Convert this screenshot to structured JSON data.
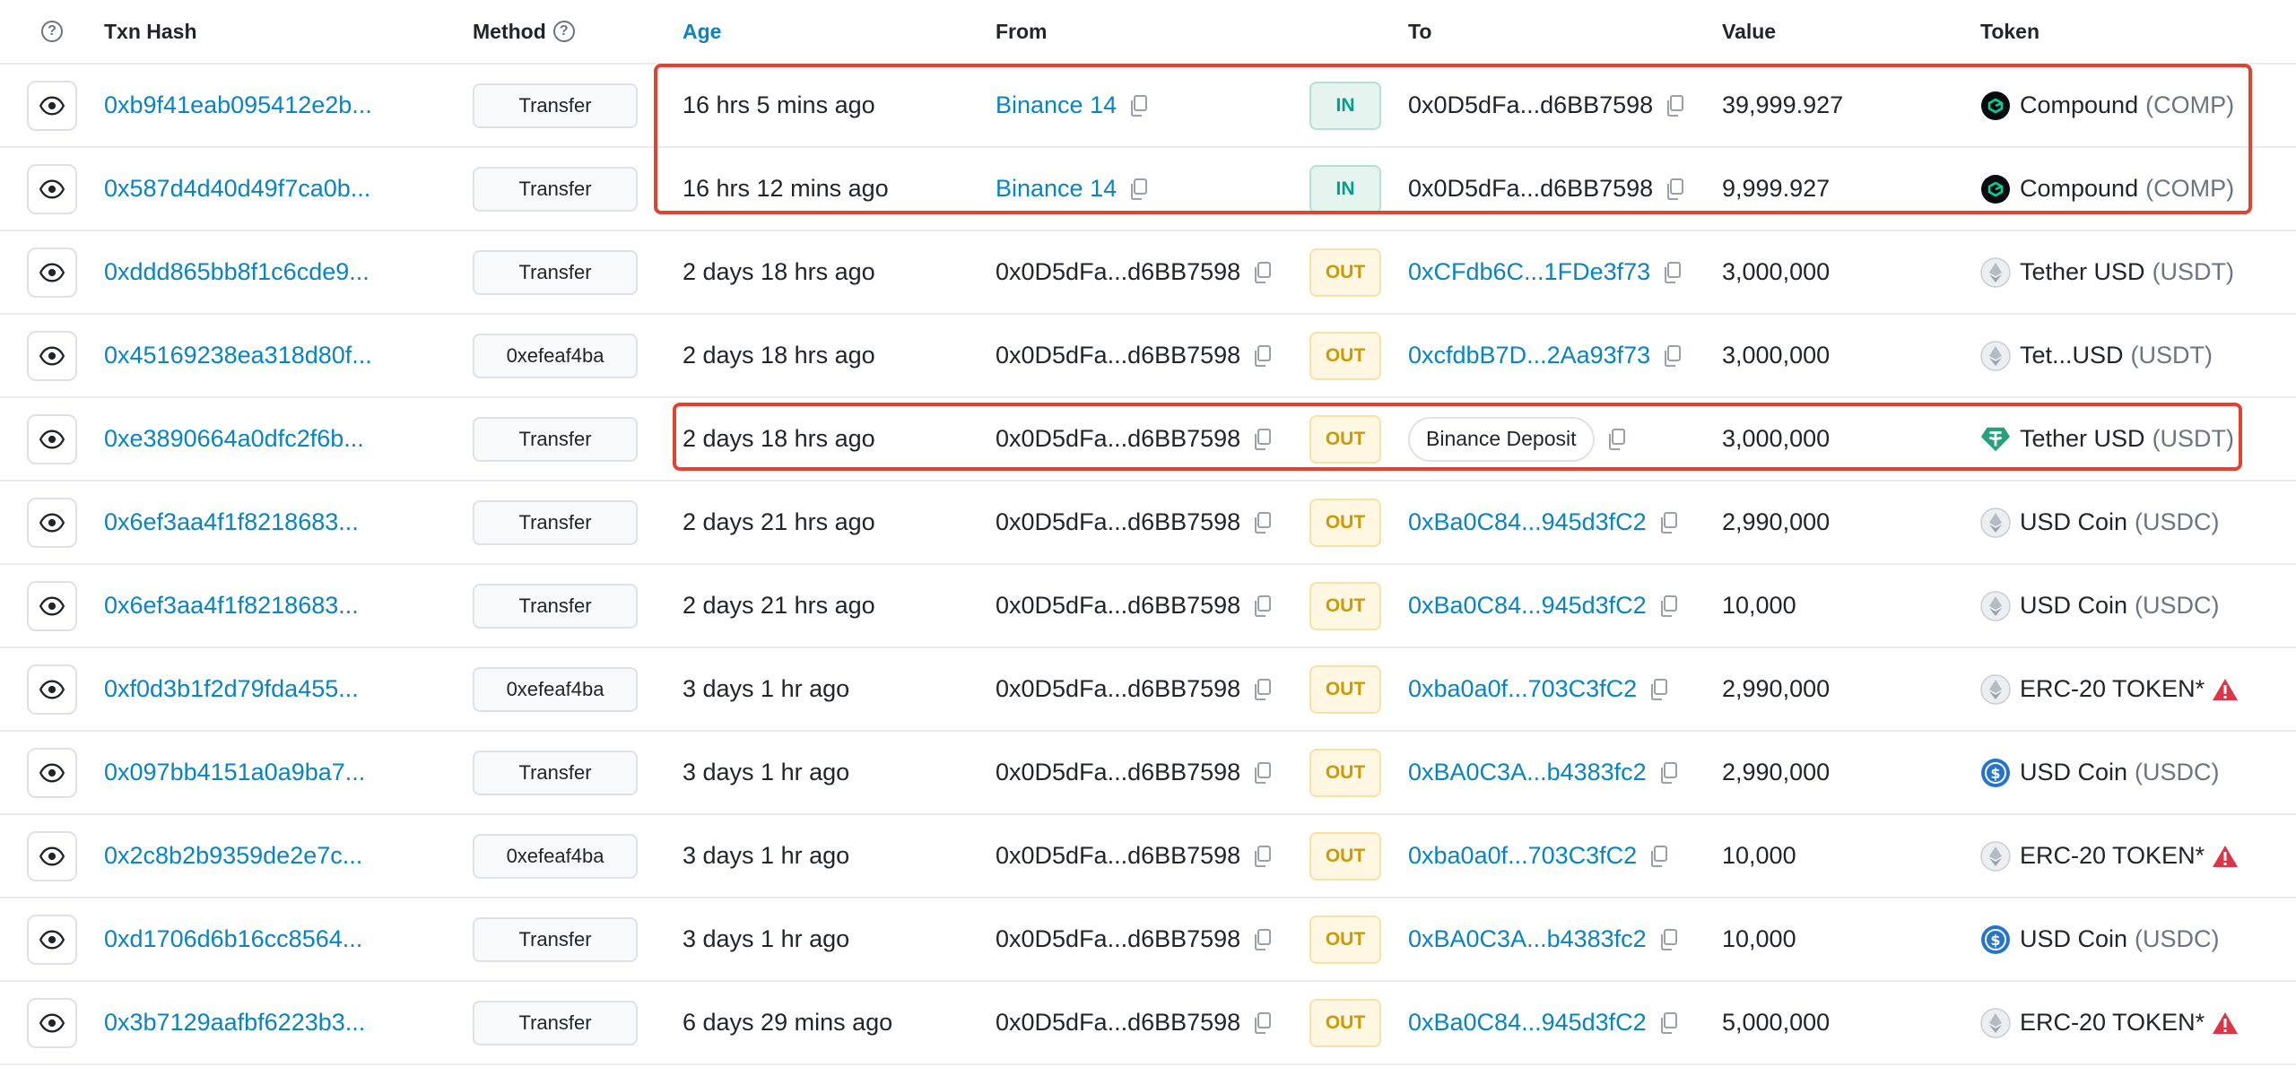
{
  "header": {
    "txn_hash": "Txn Hash",
    "method": "Method",
    "age": "Age",
    "from": "From",
    "to": "To",
    "value": "Value",
    "token": "Token"
  },
  "rows": [
    {
      "hash": "0xb9f41eab095412e2b...",
      "method": "Transfer",
      "age": "16 hrs 5 mins ago",
      "from": "Binance 14",
      "direction": "IN",
      "to": "0x0D5dFa...d6BB7598",
      "value": "39,999.927",
      "token_name": "Compound",
      "token_symbol": "(COMP)",
      "token_icon": "compound-icon"
    },
    {
      "hash": "0x587d4d40d49f7ca0b...",
      "method": "Transfer",
      "age": "16 hrs 12 mins ago",
      "from": "Binance 14",
      "direction": "IN",
      "to": "0x0D5dFa...d6BB7598",
      "value": "9,999.927",
      "token_name": "Compound",
      "token_symbol": "(COMP)",
      "token_icon": "compound-icon"
    },
    {
      "hash": "0xddd865bb8f1c6cde9...",
      "method": "Transfer",
      "age": "2 days 18 hrs ago",
      "from": "0x0D5dFa...d6BB7598",
      "direction": "OUT",
      "to": "0xCFdb6C...1FDe3f73",
      "value": "3,000,000",
      "token_name": "Tether USD",
      "token_symbol": "(USDT)",
      "token_icon": "eth-token-icon"
    },
    {
      "hash": "0x45169238ea318d80f...",
      "method": "0xefeaf4ba",
      "age": "2 days 18 hrs ago",
      "from": "0x0D5dFa...d6BB7598",
      "direction": "OUT",
      "to": "0xcfdbB7D...2Aa93f73",
      "value": "3,000,000",
      "token_name": "Tet...USD",
      "token_symbol": "(USDT)",
      "token_icon": "eth-token-icon"
    },
    {
      "hash": "0xe3890664a0dfc2f6b...",
      "method": "Transfer",
      "age": "2 days 18 hrs ago",
      "from": "0x0D5dFa...d6BB7598",
      "direction": "OUT",
      "to": "Binance Deposit",
      "value": "3,000,000",
      "token_name": "Tether USD",
      "token_symbol": "(USDT)",
      "token_icon": "tether-icon"
    },
    {
      "hash": "0x6ef3aa4f1f8218683...",
      "method": "Transfer",
      "age": "2 days 21 hrs ago",
      "from": "0x0D5dFa...d6BB7598",
      "direction": "OUT",
      "to": "0xBa0C84...945d3fC2",
      "value": "2,990,000",
      "token_name": "USD Coin",
      "token_symbol": "(USDC)",
      "token_icon": "eth-token-icon"
    },
    {
      "hash": "0x6ef3aa4f1f8218683...",
      "method": "Transfer",
      "age": "2 days 21 hrs ago",
      "from": "0x0D5dFa...d6BB7598",
      "direction": "OUT",
      "to": "0xBa0C84...945d3fC2",
      "value": "10,000",
      "token_name": "USD Coin",
      "token_symbol": "(USDC)",
      "token_icon": "eth-token-icon"
    },
    {
      "hash": "0xf0d3b1f2d79fda455...",
      "method": "0xefeaf4ba",
      "age": "3 days 1 hr ago",
      "from": "0x0D5dFa...d6BB7598",
      "direction": "OUT",
      "to": "0xba0a0f...703C3fC2",
      "value": "2,990,000",
      "token_name": "ERC-20 TOKEN*",
      "token_symbol": "",
      "token_icon": "eth-token-icon",
      "warning": true
    },
    {
      "hash": "0x097bb4151a0a9ba7...",
      "method": "Transfer",
      "age": "3 days 1 hr ago",
      "from": "0x0D5dFa...d6BB7598",
      "direction": "OUT",
      "to": "0xBA0C3A...b4383fc2",
      "value": "2,990,000",
      "token_name": "USD Coin",
      "token_symbol": "(USDC)",
      "token_icon": "usdc-icon"
    },
    {
      "hash": "0x2c8b2b9359de2e7c...",
      "method": "0xefeaf4ba",
      "age": "3 days 1 hr ago",
      "from": "0x0D5dFa...d6BB7598",
      "direction": "OUT",
      "to": "0xba0a0f...703C3fC2",
      "value": "10,000",
      "token_name": "ERC-20 TOKEN*",
      "token_symbol": "",
      "token_icon": "eth-token-icon",
      "warning": true
    },
    {
      "hash": "0xd1706d6b16cc8564...",
      "method": "Transfer",
      "age": "3 days 1 hr ago",
      "from": "0x0D5dFa...d6BB7598",
      "direction": "OUT",
      "to": "0xBA0C3A...b4383fc2",
      "value": "10,000",
      "token_name": "USD Coin",
      "token_symbol": "(USDC)",
      "token_icon": "usdc-icon"
    },
    {
      "hash": "0x3b7129aafbf6223b3...",
      "method": "Transfer",
      "age": "6 days 29 mins ago",
      "from": "0x0D5dFa...d6BB7598",
      "direction": "OUT",
      "to": "0xBa0C84...945d3fC2",
      "value": "5,000,000",
      "token_name": "ERC-20 TOKEN*",
      "token_symbol": "",
      "token_icon": "eth-token-icon",
      "warning": true
    }
  ],
  "colors": {
    "link": "#0784c3",
    "in_badge": "#00a186",
    "out_badge": "#cc9a06",
    "highlight": "#e0442e",
    "warning": "#dc3545"
  }
}
